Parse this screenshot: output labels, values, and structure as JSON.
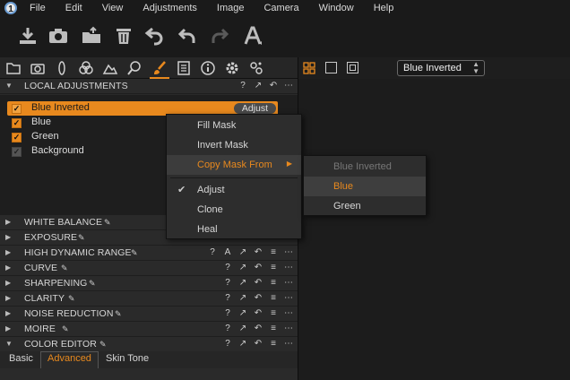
{
  "menubar": {
    "items": [
      "File",
      "Edit",
      "View",
      "Adjustments",
      "Image",
      "Camera",
      "Window",
      "Help"
    ]
  },
  "toolbar": {
    "icons": [
      "import-icon",
      "camera-icon",
      "export-icon",
      "trash-icon",
      "undo-all-icon",
      "undo-icon",
      "redo-icon",
      "text-cursor-icon"
    ]
  },
  "tool_tabs": {
    "icons": [
      "library-icon",
      "capture-icon",
      "lens-icon",
      "color-icon",
      "exposure-icon",
      "search-icon",
      "brush-icon",
      "details-icon",
      "info-icon",
      "settings-icon",
      "batch-icon"
    ],
    "active_index": 6,
    "accent": "#e8891e"
  },
  "viewer": {
    "layer_select": "Blue Inverted"
  },
  "local_adjustments": {
    "title": "LOCAL ADJUSTMENTS",
    "header_icons": [
      "?",
      "↗",
      "↶",
      "⋯"
    ],
    "layers": [
      {
        "name": "Blue Inverted",
        "checked": true,
        "selected": true,
        "badge": "Adjust"
      },
      {
        "name": "Blue",
        "checked": true,
        "selected": false,
        "badge": ""
      },
      {
        "name": "Green",
        "checked": true,
        "selected": false,
        "badge": ""
      },
      {
        "name": "Background",
        "checked": true,
        "selected": false,
        "badge": ""
      }
    ]
  },
  "sections": [
    {
      "title": "WHITE BALANCE",
      "icons": []
    },
    {
      "title": "EXPOSURE",
      "icons": []
    },
    {
      "title": "HIGH DYNAMIC RANGE",
      "icons": [
        "?",
        "A",
        "↗",
        "↶",
        "≡",
        "⋯"
      ]
    },
    {
      "title": "CURVE",
      "icons": [
        "?",
        "↗",
        "↶",
        "≡",
        "⋯"
      ]
    },
    {
      "title": "SHARPENING",
      "icons": [
        "?",
        "↗",
        "↶",
        "≡",
        "⋯"
      ]
    },
    {
      "title": "CLARITY",
      "icons": [
        "?",
        "↗",
        "↶",
        "≡",
        "⋯"
      ]
    },
    {
      "title": "NOISE REDUCTION",
      "icons": [
        "?",
        "↗",
        "↶",
        "≡",
        "⋯"
      ]
    },
    {
      "title": "MOIRE",
      "icons": [
        "?",
        "↗",
        "↶",
        "≡",
        "⋯"
      ]
    },
    {
      "title": "COLOR EDITOR",
      "icons": [
        "?",
        "↗",
        "↶",
        "≡",
        "⋯"
      ]
    }
  ],
  "color_editor_tabs": [
    {
      "label": "Basic",
      "active": false
    },
    {
      "label": "Advanced",
      "active": true
    },
    {
      "label": "Skin Tone",
      "active": false
    }
  ],
  "context_menu": {
    "items": [
      {
        "label": "Fill Mask",
        "type": "item"
      },
      {
        "label": "Invert Mask",
        "type": "item"
      },
      {
        "label": "Copy Mask From",
        "type": "submenu",
        "highlighted": true
      },
      {
        "label": "Adjust",
        "type": "item",
        "checked": true
      },
      {
        "label": "Clone",
        "type": "item"
      },
      {
        "label": "Heal",
        "type": "item"
      }
    ]
  },
  "submenu": {
    "items": [
      {
        "label": "Blue Inverted",
        "state": "disabled"
      },
      {
        "label": "Blue",
        "state": "highlighted"
      },
      {
        "label": "Green",
        "state": "normal"
      }
    ]
  }
}
